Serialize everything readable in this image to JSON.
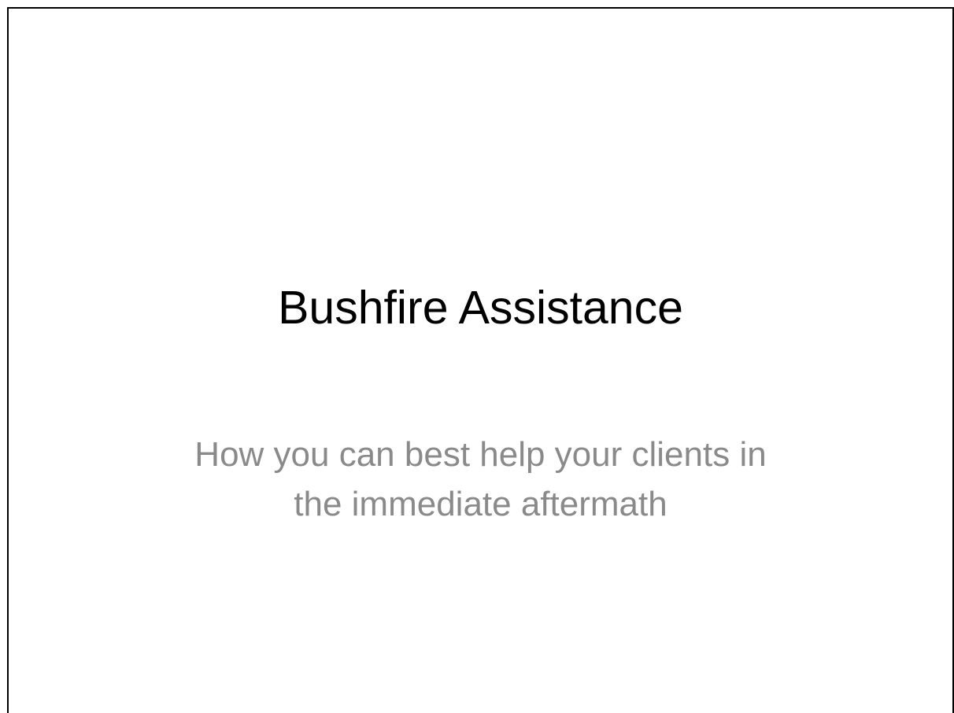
{
  "slide": {
    "title": "Bushfire Assistance",
    "subtitle_lines": [
      "How you can best help your clients in",
      "the immediate aftermath"
    ]
  },
  "colors": {
    "title": "#000000",
    "subtitle": "#8a8a8a",
    "background": "#ffffff",
    "border": "#000000"
  }
}
